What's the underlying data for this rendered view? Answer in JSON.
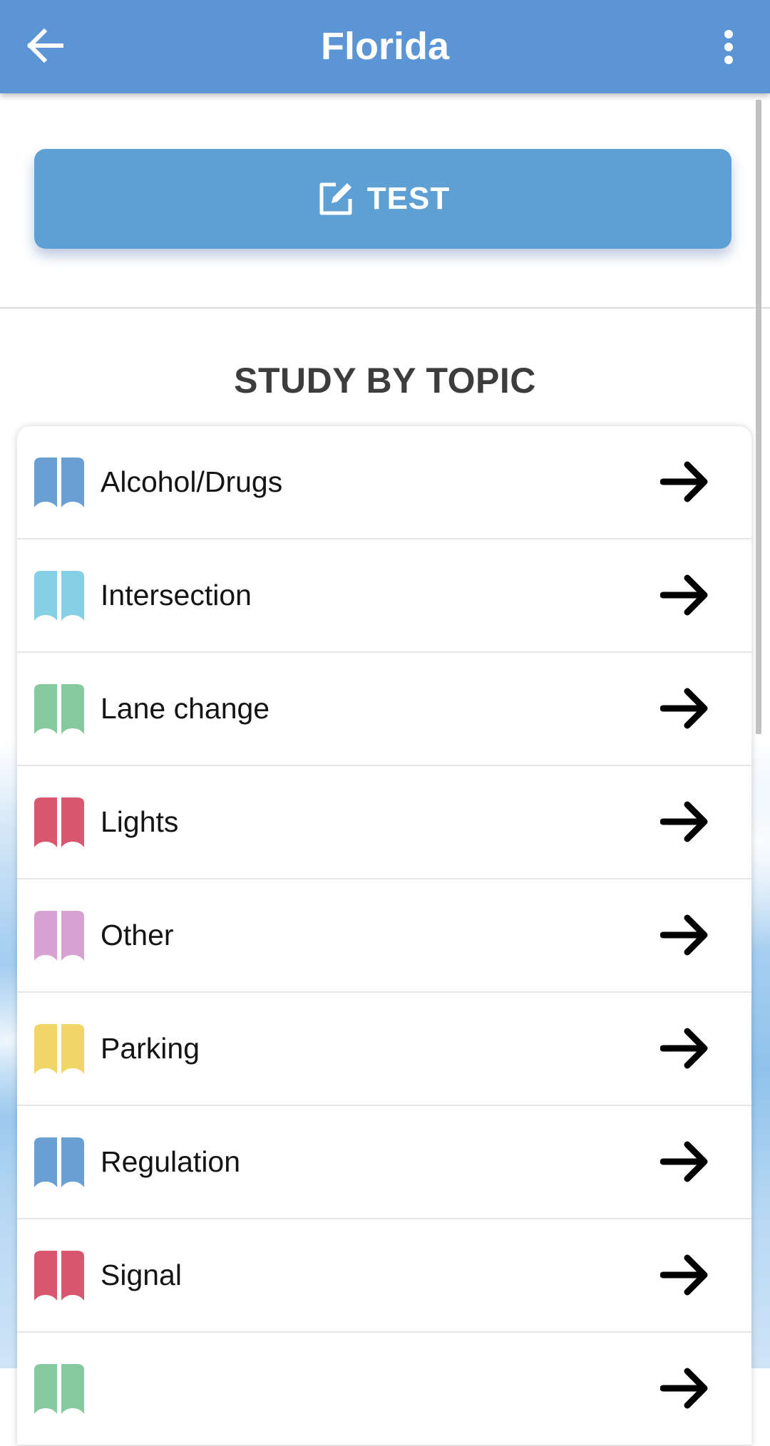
{
  "appbar": {
    "title": "Florida",
    "back_icon": "arrow-left-icon",
    "menu_icon": "more-vert-icon",
    "color": "#5b95d5"
  },
  "test_button": {
    "label": "TEST",
    "icon": "edit-icon",
    "color": "#5e9fd4"
  },
  "section": {
    "title": "STUDY BY TOPIC"
  },
  "topics": [
    {
      "label": "Alcohol/Drugs",
      "color": "#6a9fd4"
    },
    {
      "label": "Intersection",
      "color": "#86d0e6"
    },
    {
      "label": "Lane change",
      "color": "#86c99e"
    },
    {
      "label": "Lights",
      "color": "#d9566f"
    },
    {
      "label": "Other",
      "color": "#d6a2d2"
    },
    {
      "label": "Parking",
      "color": "#f1d667"
    },
    {
      "label": "Regulation",
      "color": "#6a9fd4"
    },
    {
      "label": "Signal",
      "color": "#d9566f"
    },
    {
      "label": "",
      "color": "#86c99e"
    }
  ],
  "row_icons": {
    "leading": "book-icon",
    "trailing": "arrow-right-icon"
  }
}
